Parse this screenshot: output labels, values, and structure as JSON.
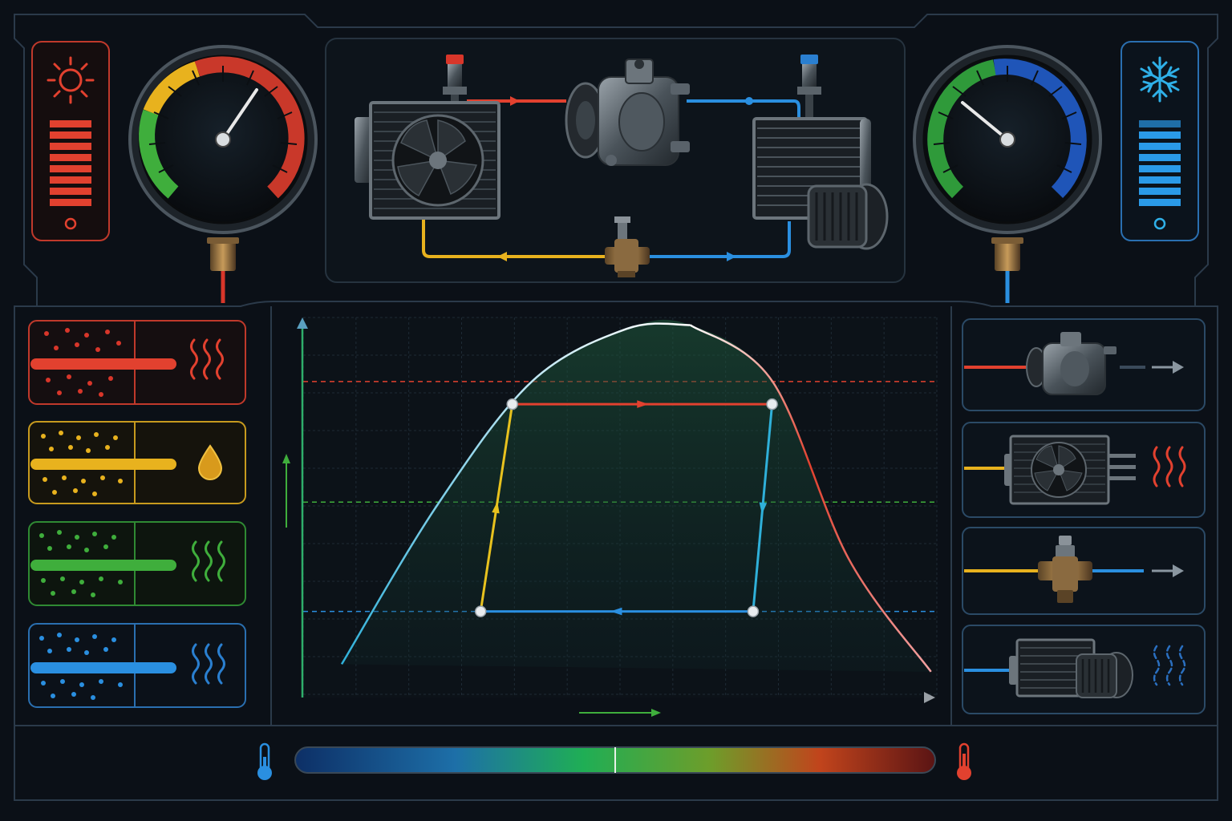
{
  "theme": {
    "background": "#0b1017",
    "frame": "#2b3a4a",
    "hot": "#e2412f",
    "warm": "#e8b21e",
    "mid": "#3fae3c",
    "cold": "#2a8fe0",
    "curve": "#ffffff",
    "liquid_side": "#2fb0d9",
    "vapor_side": "#e2412f"
  },
  "indicators": {
    "hot_panel": {
      "icon": "sun-icon",
      "level": 1.0
    },
    "cold_panel": {
      "icon": "snowflake-icon",
      "level": 1.0
    }
  },
  "gauges": {
    "high_pressure": {
      "needle_fraction": 0.7,
      "zones": [
        "#3fae3c",
        "#e8b21e",
        "#e2412f"
      ]
    },
    "low_pressure": {
      "needle_fraction": 0.35,
      "zones": [
        "#3fae3c",
        "#2a6fd0"
      ]
    }
  },
  "system_diagram": {
    "components": [
      "condenser-icon",
      "compressor-icon",
      "evaporator-icon",
      "blower-icon",
      "expansion-valve-icon",
      "service-valve-icon"
    ],
    "lines": [
      {
        "from": "condenser",
        "to": "compressor",
        "color": "#e2412f"
      },
      {
        "from": "compressor",
        "to": "evaporator",
        "color": "#2a8fe0"
      },
      {
        "from": "evaporator",
        "to": "expansion-valve",
        "color": "#2a8fe0"
      },
      {
        "from": "expansion-valve",
        "to": "condenser",
        "color": "#e8b21e"
      }
    ]
  },
  "state_legend": [
    {
      "state": "hot-vapor",
      "color": "#e2412f",
      "icon": "heat-waves-icon"
    },
    {
      "state": "warm-liquid",
      "color": "#e8b21e",
      "icon": "droplet-icon"
    },
    {
      "state": "mid-mixture",
      "color": "#3fae3c",
      "icon": "heat-waves-icon"
    },
    {
      "state": "cold-vapor",
      "color": "#2a8fe0",
      "icon": "heat-waves-icon"
    }
  ],
  "component_list": [
    {
      "icon": "compressor-icon",
      "line_color": "#e2412f",
      "indicator": "arrow-icon"
    },
    {
      "icon": "condenser-icon",
      "line_color": "#e8b21e",
      "indicator": "heat-waves-icon"
    },
    {
      "icon": "expansion-valve-icon",
      "line_color": "#e8b21e",
      "indicator": "arrow-icon"
    },
    {
      "icon": "evaporator-icon",
      "line_color": "#2a8fe0",
      "indicator": "heat-waves-icon"
    }
  ],
  "cycle_chart": {
    "dome": [
      [
        0,
        0.08
      ],
      [
        0.15,
        0.5
      ],
      [
        0.3,
        0.83
      ],
      [
        0.45,
        0.97
      ],
      [
        0.55,
        0.98
      ],
      [
        0.68,
        0.83
      ],
      [
        0.8,
        0.36
      ],
      [
        0.93,
        0.06
      ]
    ],
    "cycle_points": [
      [
        0.33,
        0.77
      ],
      [
        0.74,
        0.77
      ],
      [
        0.71,
        0.22
      ],
      [
        0.28,
        0.22
      ]
    ],
    "reference_levels": [
      {
        "level": 0.83,
        "color": "#e2412f"
      },
      {
        "level": 0.51,
        "color": "#3fae3c"
      },
      {
        "level": 0.22,
        "color": "#2a8fe0"
      }
    ]
  },
  "temperature_scale": {
    "cold_icon": "thermometer-cold-icon",
    "hot_icon": "thermometer-hot-icon",
    "marker_fraction": 0.5
  }
}
